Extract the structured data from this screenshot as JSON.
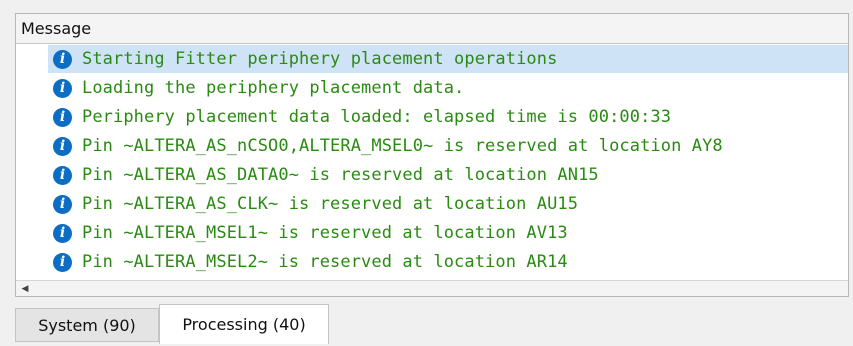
{
  "panel": {
    "header_label": "Message",
    "messages": [
      {
        "text": "Starting Fitter periphery placement operations",
        "selected": true
      },
      {
        "text": "Loading the periphery placement data."
      },
      {
        "text": "Periphery placement data loaded: elapsed time is 00:00:33"
      },
      {
        "text": "Pin ~ALTERA_AS_nCSO0,ALTERA_MSEL0~ is reserved at location AY8"
      },
      {
        "text": "Pin ~ALTERA_AS_DATA0~ is reserved at location AN15"
      },
      {
        "text": "Pin ~ALTERA_AS_CLK~ is reserved at location AU15"
      },
      {
        "text": "Pin ~ALTERA_MSEL1~ is reserved at location AV13"
      },
      {
        "text": "Pin ~ALTERA_MSEL2~ is reserved at location AR14"
      }
    ],
    "icon": "info-icon",
    "message_color": "#2a8a12",
    "icon_color": "#0b6dc4",
    "selection_color": "#cfe3f7"
  },
  "tabs": [
    {
      "label": "System (90)",
      "active": false
    },
    {
      "label": "Processing (40)",
      "active": true
    }
  ]
}
